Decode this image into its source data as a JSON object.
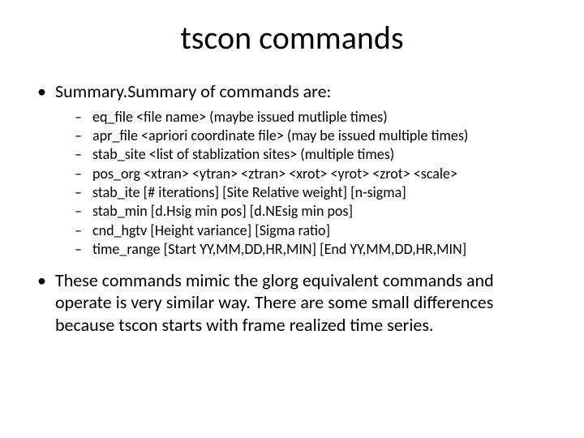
{
  "title": "tscon commands",
  "bullets": {
    "summary": "Summary.Summary of commands are:",
    "items": [
      " eq_file <file name>  (maybe issued mutliple times)",
      "apr_file <apriori coordinate file> (may be issued multiple times)",
      "stab_site <list of stablization sites> (multiple times)",
      "pos_org <xtran> <ytran> <ztran> <xrot> <yrot> <zrot> <scale>",
      "stab_ite [# iterations] [Site Relative weight] [n-sigma]",
      "stab_min [d.Hsig min pos] [d.NEsig min pos]",
      "cnd_hgtv [Height variance] [Sigma ratio]",
      "time_range [Start YY,MM,DD,HR,MIN] [End YY,MM,DD,HR,MIN]"
    ],
    "footer": "These commands mimic the glorg equivalent commands and operate is very similar way.  There are some small differences because tscon starts with frame realized time series."
  }
}
